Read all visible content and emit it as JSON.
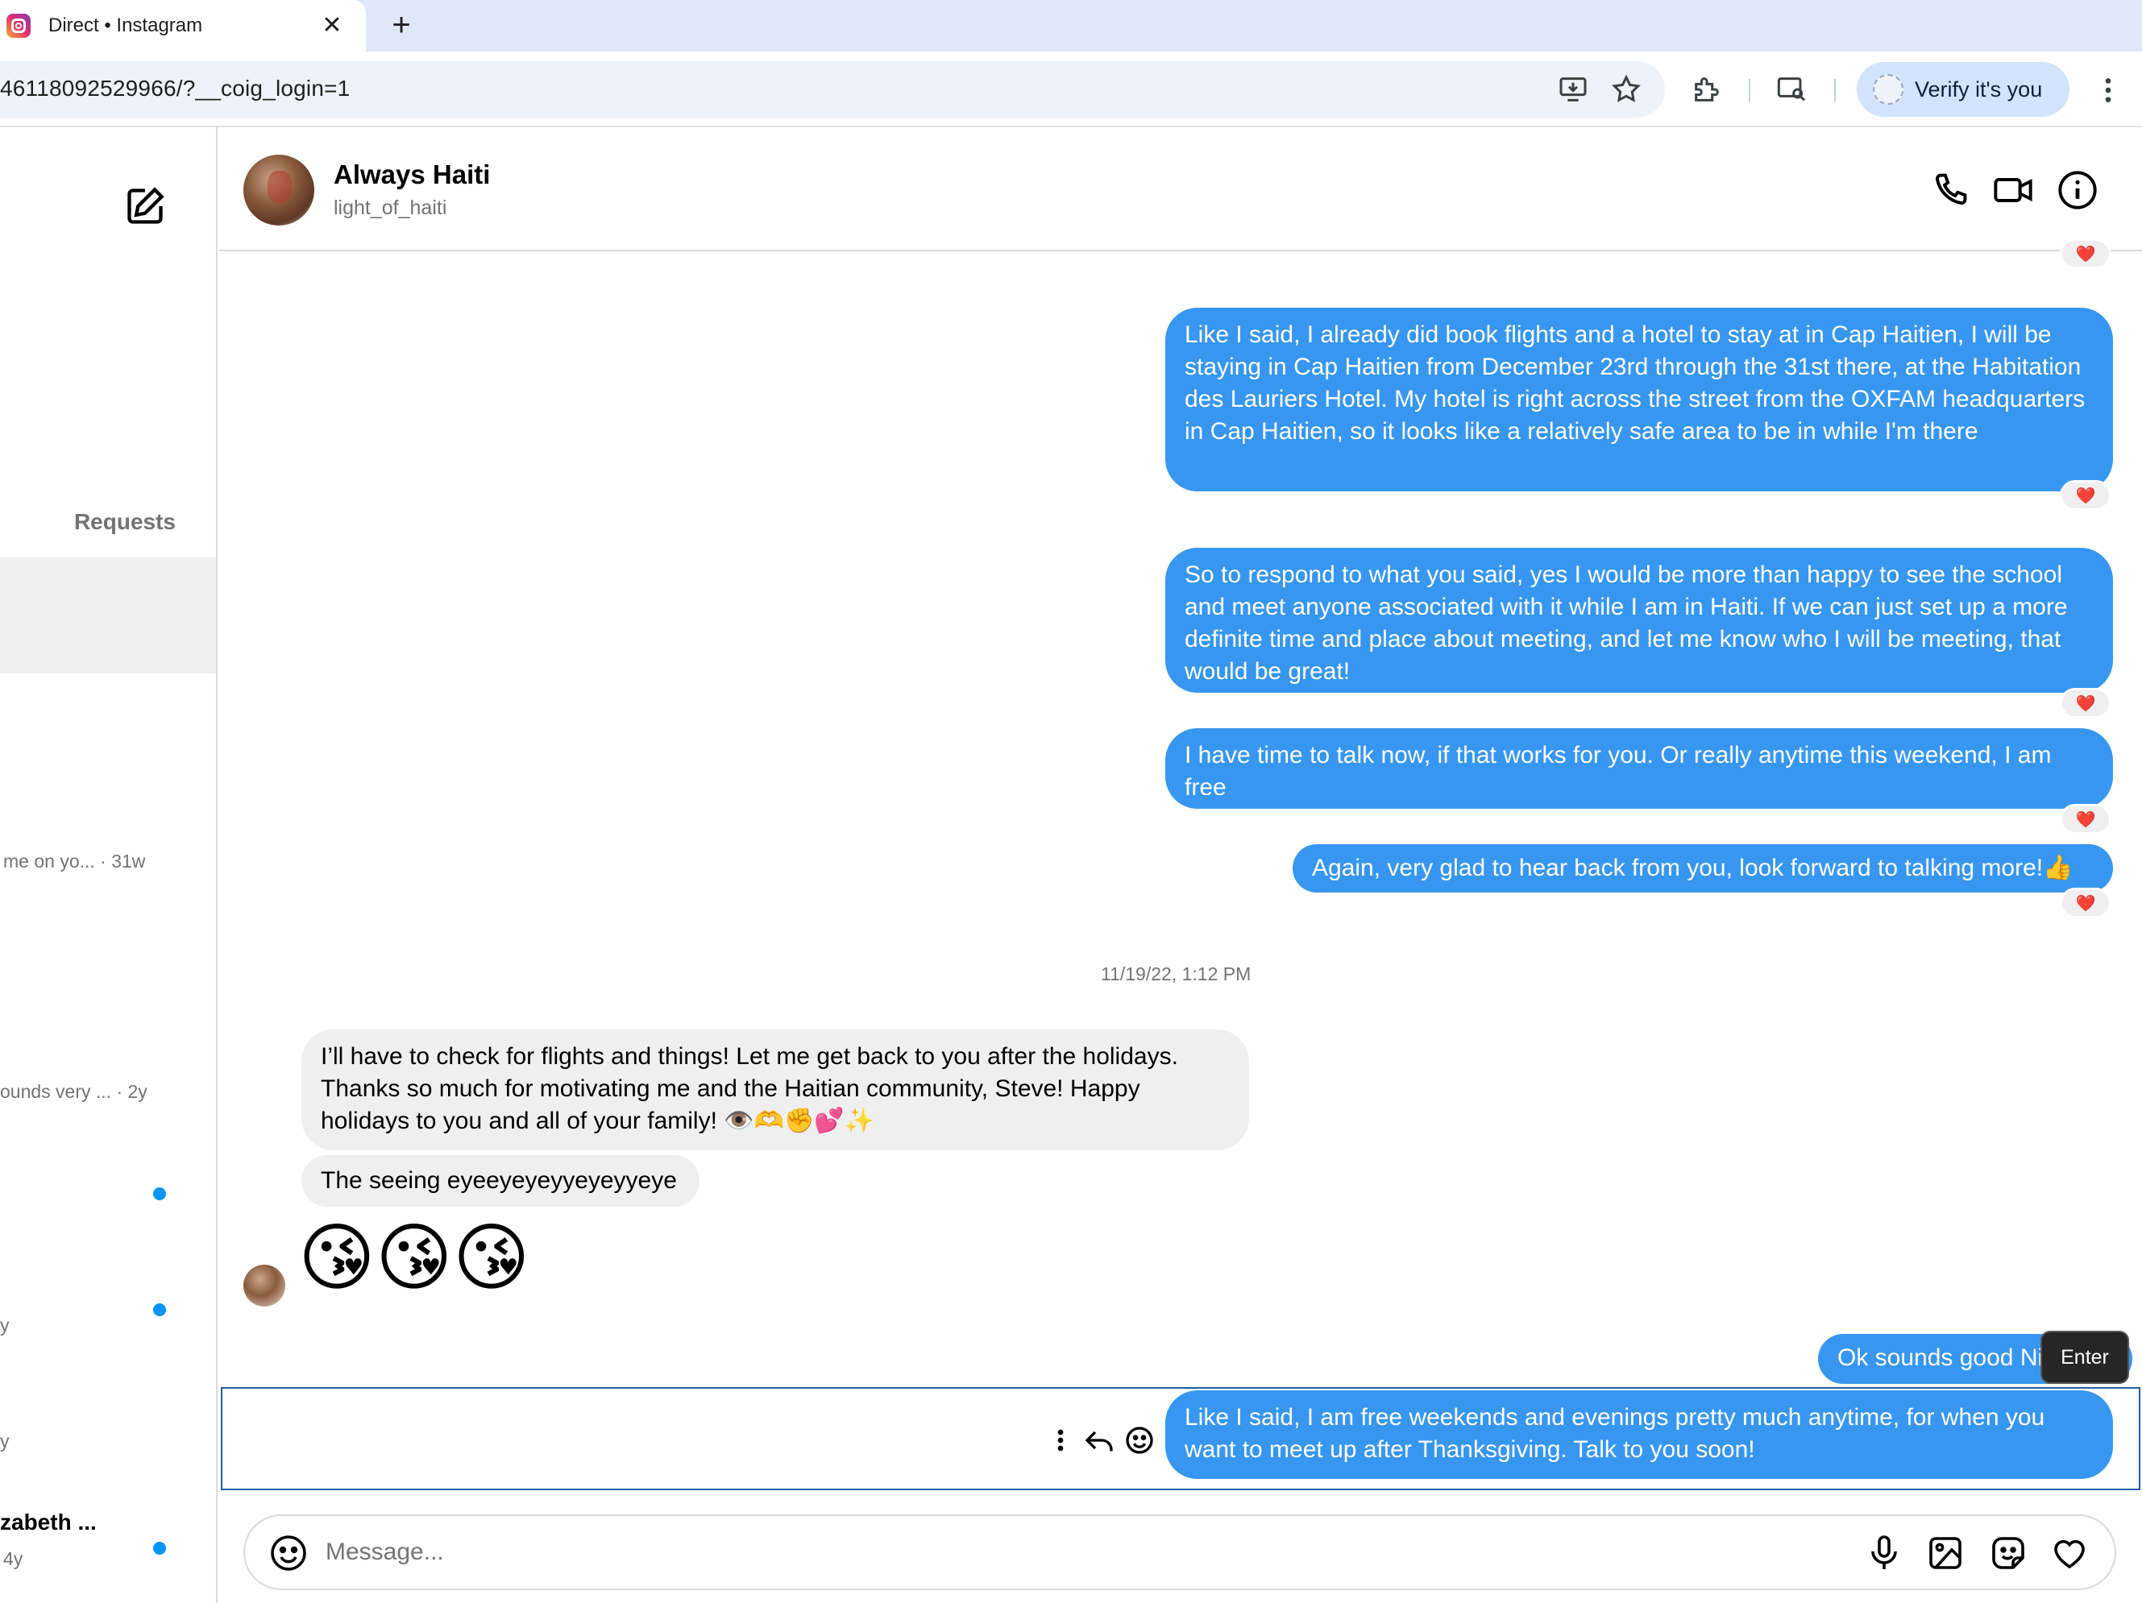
{
  "browser": {
    "tab_title": "Direct • Instagram",
    "url": "46118092529966/?__coig_login=1",
    "profile_button": "Verify it's you"
  },
  "sidebar": {
    "requests_label": "Requests",
    "items": [
      {
        "snippet": "me on yo...",
        "age": "· 31w"
      },
      {
        "snippet": "ounds very ...",
        "age": "· 2y"
      },
      {
        "snippet": "y",
        "age": ""
      },
      {
        "snippet": "y",
        "age": ""
      },
      {
        "name": "zabeth ...",
        "age": "4y"
      }
    ]
  },
  "conversation": {
    "name": "Always Haiti",
    "handle": "light_of_haiti"
  },
  "messages": [
    {
      "from": "me",
      "text": "Like I said, I already did book flights and a hotel to stay at in Cap Haitien, I will be staying in Cap Haitien from December 23rd through the 31st there, at the Habitation des Lauriers Hotel. My hotel  is right across the street from the OXFAM headquarters in Cap Haitien, so it looks like a relatively safe area to be in while I'm there",
      "reaction": "❤️"
    },
    {
      "from": "me",
      "text": "So to respond to what you said, yes I would be more than happy to see the school and meet anyone associated with it while I am in Haiti. If we can just set up a more definite time and place about meeting, and let me know who I will be meeting, that would be great!",
      "reaction": "❤️"
    },
    {
      "from": "me",
      "text": "I have time to talk now, if that works for you. Or really anytime this weekend, I am free",
      "reaction": "❤️"
    },
    {
      "from": "me",
      "text": "Again, very glad to hear back from you, look forward to talking more!👍",
      "reaction": "❤️"
    },
    {
      "from": "them",
      "text": "I’ll have to check for flights and things! Let me get back to you after the holidays. Thanks so much for motivating me and the Haitian community, Steve! Happy holidays to you and all of your family! 👁️🫶✊💕✨"
    },
    {
      "from": "them",
      "text": "The seeing eyeeyeyeyyeyeyyeye"
    },
    {
      "from": "them",
      "text": "😘😘😘"
    },
    {
      "from": "me",
      "text": "Ok sounds good Ni"
    },
    {
      "from": "me",
      "text": "Like I said, I am free weekends and evenings pretty much anytime, for when you want to meet up after Thanksgiving. Talk to you soon!"
    }
  ],
  "timestamp": "11/19/22, 1:12 PM",
  "tooltip": "Enter",
  "top_reaction": "❤️",
  "composer": {
    "placeholder": "Message..."
  },
  "colors": {
    "outgoing_bubble": "#3797f0",
    "incoming_bubble": "#efefef",
    "unread_dot": "#0095f6"
  }
}
